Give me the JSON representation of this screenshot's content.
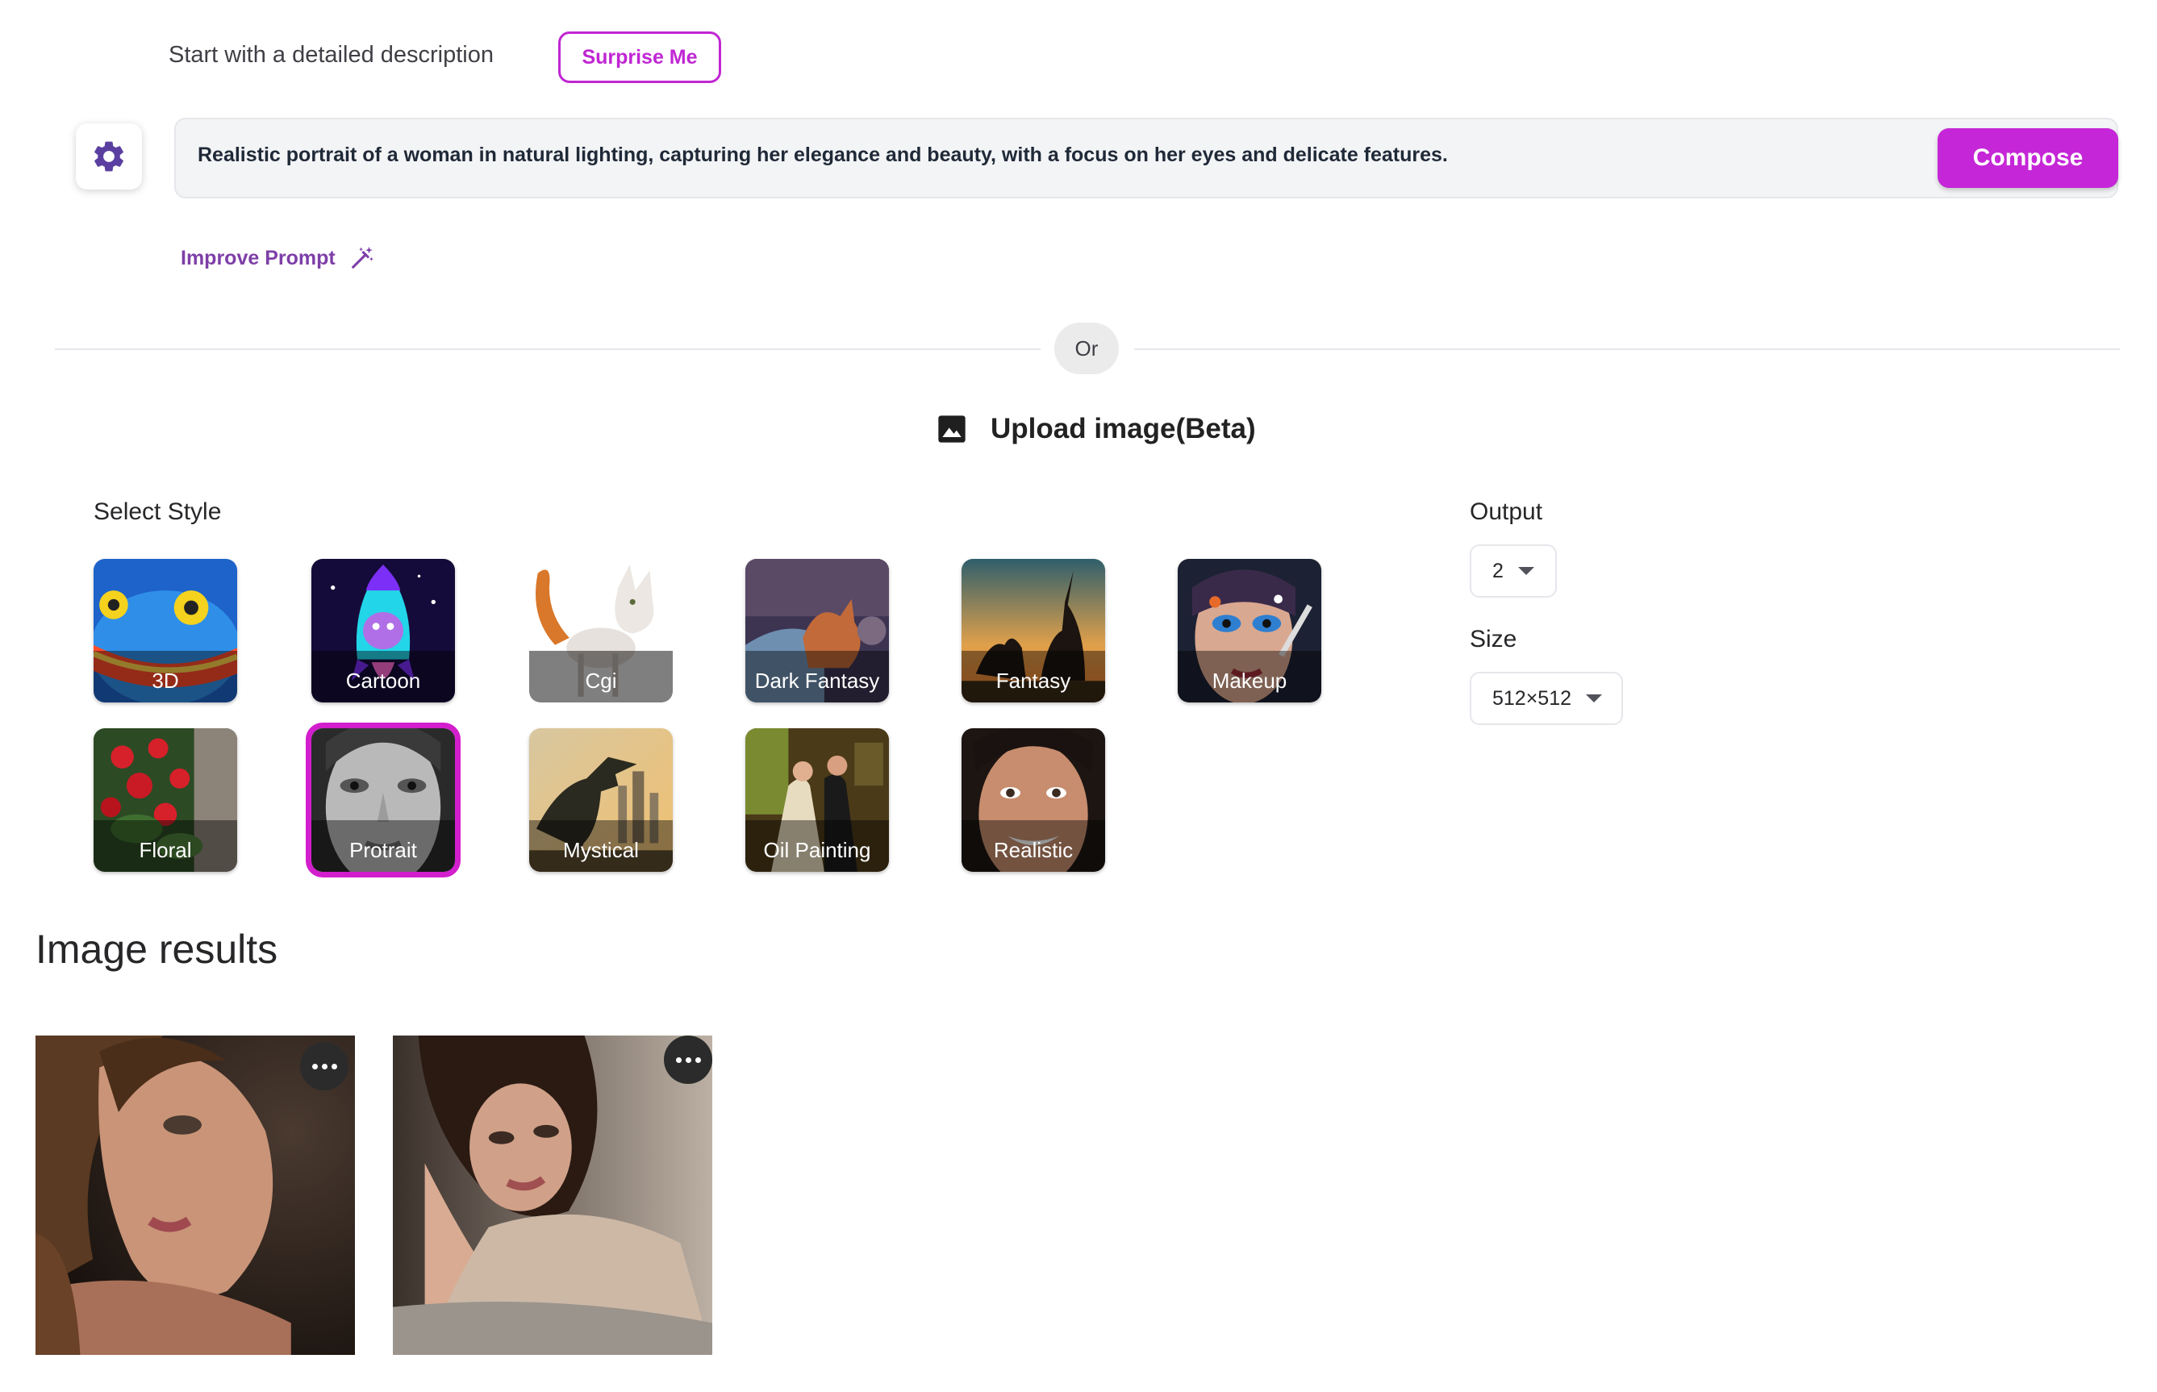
{
  "header": {
    "headline": "Start with a detailed description",
    "surprise_label": "Surprise Me"
  },
  "prompt": {
    "text": "Realistic portrait of a woman in natural lighting, capturing her elegance and beauty, with a focus on her eyes and delicate features.",
    "compose_label": "Compose",
    "improve_label": "Improve Prompt"
  },
  "divider": {
    "or_label": "Or"
  },
  "upload": {
    "label": "Upload image(Beta)"
  },
  "styles": {
    "label": "Select Style",
    "selected": "Protrait",
    "items": [
      {
        "label": "3D"
      },
      {
        "label": "Cartoon"
      },
      {
        "label": "Cgi"
      },
      {
        "label": "Dark Fantasy"
      },
      {
        "label": "Fantasy"
      },
      {
        "label": "Makeup"
      },
      {
        "label": "Floral"
      },
      {
        "label": "Protrait"
      },
      {
        "label": "Mystical"
      },
      {
        "label": "Oil Painting"
      },
      {
        "label": "Realistic"
      }
    ]
  },
  "settings": {
    "output_label": "Output",
    "output_value": "2",
    "size_label": "Size",
    "size_value": "512×512"
  },
  "results": {
    "title": "Image results"
  },
  "colors": {
    "accent": "#c526d7",
    "improve": "#7e3fa8",
    "gear": "#5b3fa0"
  }
}
